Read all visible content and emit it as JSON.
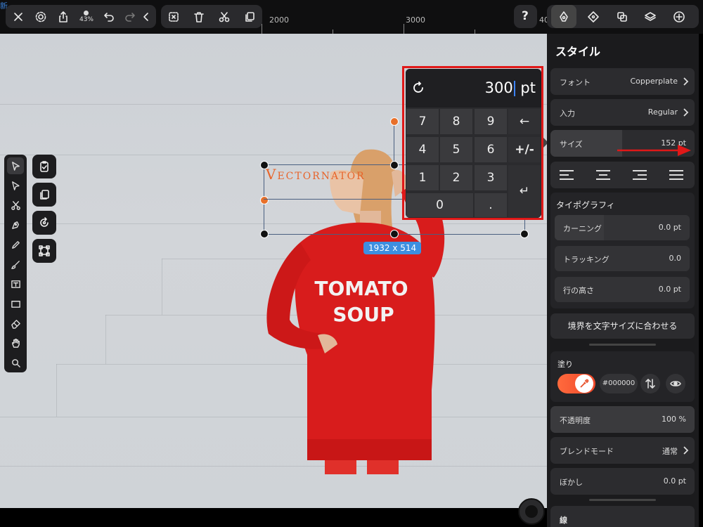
{
  "topbar": {
    "ghost_text": "新",
    "zoom_level": "43%",
    "help_label": "?",
    "ruler_labels": [
      "2000",
      "3000",
      "40"
    ]
  },
  "canvas": {
    "text_object": "Vectornator",
    "size_badge": "1932 x 514",
    "tshirt_line1": "TOMATO",
    "tshirt_line2": "SOUP"
  },
  "keypad": {
    "value": "300",
    "unit": "pt",
    "keys": [
      "7",
      "8",
      "9",
      "←",
      "4",
      "5",
      "6",
      "+/-",
      "1",
      "2",
      "3",
      "↵",
      "0",
      "."
    ]
  },
  "panel": {
    "title": "スタイル",
    "font": {
      "label": "フォント",
      "value": "Copperplate"
    },
    "input": {
      "label": "入力",
      "value": "Regular"
    },
    "size": {
      "label": "サイズ",
      "value": "152 pt"
    },
    "typography": {
      "title": "タイポグラフィ",
      "kerning": {
        "label": "カーニング",
        "value": "0.0 pt"
      },
      "tracking": {
        "label": "トラッキング",
        "value": "0.0"
      },
      "line_height": {
        "label": "行の高さ",
        "value": "0.0 pt"
      }
    },
    "fit_button": "境界を文字サイズに合わせる",
    "fill": {
      "title": "塗り",
      "hex": "#000000",
      "swatch_color": "#f0482a"
    },
    "opacity": {
      "label": "不透明度",
      "value": "100 %"
    },
    "blend_mode": {
      "label": "ブレンドモード",
      "value": "通常"
    },
    "blur": {
      "label": "ぼかし",
      "value": "0.0 pt"
    },
    "stroke": {
      "label": "線"
    }
  },
  "colors": {
    "accent_blue": "#3d8fe0",
    "highlight_red": "#e01818",
    "text_orange": "#e8642a"
  }
}
